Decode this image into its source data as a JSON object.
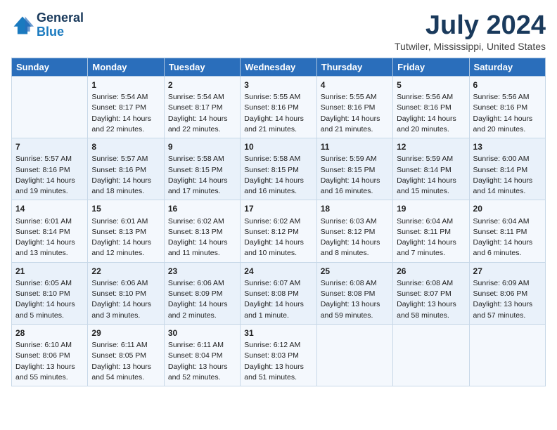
{
  "logo": {
    "line1": "General",
    "line2": "Blue"
  },
  "title": "July 2024",
  "subtitle": "Tutwiler, Mississippi, United States",
  "days_of_week": [
    "Sunday",
    "Monday",
    "Tuesday",
    "Wednesday",
    "Thursday",
    "Friday",
    "Saturday"
  ],
  "weeks": [
    [
      {
        "day": "",
        "content": ""
      },
      {
        "day": "1",
        "content": "Sunrise: 5:54 AM\nSunset: 8:17 PM\nDaylight: 14 hours\nand 22 minutes."
      },
      {
        "day": "2",
        "content": "Sunrise: 5:54 AM\nSunset: 8:17 PM\nDaylight: 14 hours\nand 22 minutes."
      },
      {
        "day": "3",
        "content": "Sunrise: 5:55 AM\nSunset: 8:16 PM\nDaylight: 14 hours\nand 21 minutes."
      },
      {
        "day": "4",
        "content": "Sunrise: 5:55 AM\nSunset: 8:16 PM\nDaylight: 14 hours\nand 21 minutes."
      },
      {
        "day": "5",
        "content": "Sunrise: 5:56 AM\nSunset: 8:16 PM\nDaylight: 14 hours\nand 20 minutes."
      },
      {
        "day": "6",
        "content": "Sunrise: 5:56 AM\nSunset: 8:16 PM\nDaylight: 14 hours\nand 20 minutes."
      }
    ],
    [
      {
        "day": "7",
        "content": "Sunrise: 5:57 AM\nSunset: 8:16 PM\nDaylight: 14 hours\nand 19 minutes."
      },
      {
        "day": "8",
        "content": "Sunrise: 5:57 AM\nSunset: 8:16 PM\nDaylight: 14 hours\nand 18 minutes."
      },
      {
        "day": "9",
        "content": "Sunrise: 5:58 AM\nSunset: 8:15 PM\nDaylight: 14 hours\nand 17 minutes."
      },
      {
        "day": "10",
        "content": "Sunrise: 5:58 AM\nSunset: 8:15 PM\nDaylight: 14 hours\nand 16 minutes."
      },
      {
        "day": "11",
        "content": "Sunrise: 5:59 AM\nSunset: 8:15 PM\nDaylight: 14 hours\nand 16 minutes."
      },
      {
        "day": "12",
        "content": "Sunrise: 5:59 AM\nSunset: 8:14 PM\nDaylight: 14 hours\nand 15 minutes."
      },
      {
        "day": "13",
        "content": "Sunrise: 6:00 AM\nSunset: 8:14 PM\nDaylight: 14 hours\nand 14 minutes."
      }
    ],
    [
      {
        "day": "14",
        "content": "Sunrise: 6:01 AM\nSunset: 8:14 PM\nDaylight: 14 hours\nand 13 minutes."
      },
      {
        "day": "15",
        "content": "Sunrise: 6:01 AM\nSunset: 8:13 PM\nDaylight: 14 hours\nand 12 minutes."
      },
      {
        "day": "16",
        "content": "Sunrise: 6:02 AM\nSunset: 8:13 PM\nDaylight: 14 hours\nand 11 minutes."
      },
      {
        "day": "17",
        "content": "Sunrise: 6:02 AM\nSunset: 8:12 PM\nDaylight: 14 hours\nand 10 minutes."
      },
      {
        "day": "18",
        "content": "Sunrise: 6:03 AM\nSunset: 8:12 PM\nDaylight: 14 hours\nand 8 minutes."
      },
      {
        "day": "19",
        "content": "Sunrise: 6:04 AM\nSunset: 8:11 PM\nDaylight: 14 hours\nand 7 minutes."
      },
      {
        "day": "20",
        "content": "Sunrise: 6:04 AM\nSunset: 8:11 PM\nDaylight: 14 hours\nand 6 minutes."
      }
    ],
    [
      {
        "day": "21",
        "content": "Sunrise: 6:05 AM\nSunset: 8:10 PM\nDaylight: 14 hours\nand 5 minutes."
      },
      {
        "day": "22",
        "content": "Sunrise: 6:06 AM\nSunset: 8:10 PM\nDaylight: 14 hours\nand 3 minutes."
      },
      {
        "day": "23",
        "content": "Sunrise: 6:06 AM\nSunset: 8:09 PM\nDaylight: 14 hours\nand 2 minutes."
      },
      {
        "day": "24",
        "content": "Sunrise: 6:07 AM\nSunset: 8:08 PM\nDaylight: 14 hours\nand 1 minute."
      },
      {
        "day": "25",
        "content": "Sunrise: 6:08 AM\nSunset: 8:08 PM\nDaylight: 13 hours\nand 59 minutes."
      },
      {
        "day": "26",
        "content": "Sunrise: 6:08 AM\nSunset: 8:07 PM\nDaylight: 13 hours\nand 58 minutes."
      },
      {
        "day": "27",
        "content": "Sunrise: 6:09 AM\nSunset: 8:06 PM\nDaylight: 13 hours\nand 57 minutes."
      }
    ],
    [
      {
        "day": "28",
        "content": "Sunrise: 6:10 AM\nSunset: 8:06 PM\nDaylight: 13 hours\nand 55 minutes."
      },
      {
        "day": "29",
        "content": "Sunrise: 6:11 AM\nSunset: 8:05 PM\nDaylight: 13 hours\nand 54 minutes."
      },
      {
        "day": "30",
        "content": "Sunrise: 6:11 AM\nSunset: 8:04 PM\nDaylight: 13 hours\nand 52 minutes."
      },
      {
        "day": "31",
        "content": "Sunrise: 6:12 AM\nSunset: 8:03 PM\nDaylight: 13 hours\nand 51 minutes."
      },
      {
        "day": "",
        "content": ""
      },
      {
        "day": "",
        "content": ""
      },
      {
        "day": "",
        "content": ""
      }
    ]
  ]
}
